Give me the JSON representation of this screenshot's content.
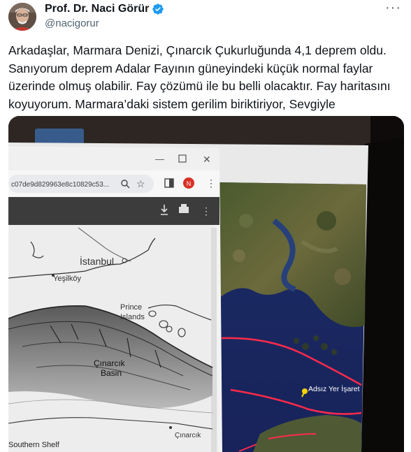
{
  "author": {
    "display_name": "Prof. Dr. Naci Görür",
    "handle": "@nacigorur",
    "verified": true,
    "verified_icon": "verified-badge-icon",
    "avatar_icon": "avatar-photo"
  },
  "tweet": {
    "lines": [
      "Arkadaşlar, Marmara Denizi, Çınarcık Çukurluğunda 4,1 deprem oldu.",
      "Sanıyorum deprem Adalar Fayının güneyindeki küçük normal faylar",
      "üzerinde olmuş olabilir. Fay çözümü ile bu belli olacaktır. Fay haritasını",
      "koyuyorum. Marmara’daki sistem gerilim biriktiriyor, Sevgiyle"
    ]
  },
  "media": {
    "browser": {
      "url": "c07de9d829963e8c10829c53...",
      "profile_initial": "N",
      "window_controls": [
        "minimize-icon",
        "maximize-icon",
        "close-icon"
      ],
      "toolbar_icons": [
        "zoom-icon",
        "star-icon",
        "sidebar-icon",
        "more-icon"
      ],
      "pdf_icons": [
        "download-icon",
        "print-icon",
        "more-icon"
      ]
    },
    "fault_map_labels": {
      "istanbul": "İstanbul",
      "yesilkoy": "Yeşilköy",
      "prince_islands_1": "Prince",
      "prince_islands_2": "Islands",
      "cinarcik_basin_1": "Çınarcık",
      "cinarcik_basin_2": "Basin",
      "southern_shelf": "Southern Shelf",
      "cinarcik_town": "Çınarcık"
    },
    "satellite": {
      "pin_label": "Adsız Yer İşaret",
      "pin_color": "#f5d400",
      "fault_line_color": "#ff2a4a"
    }
  }
}
